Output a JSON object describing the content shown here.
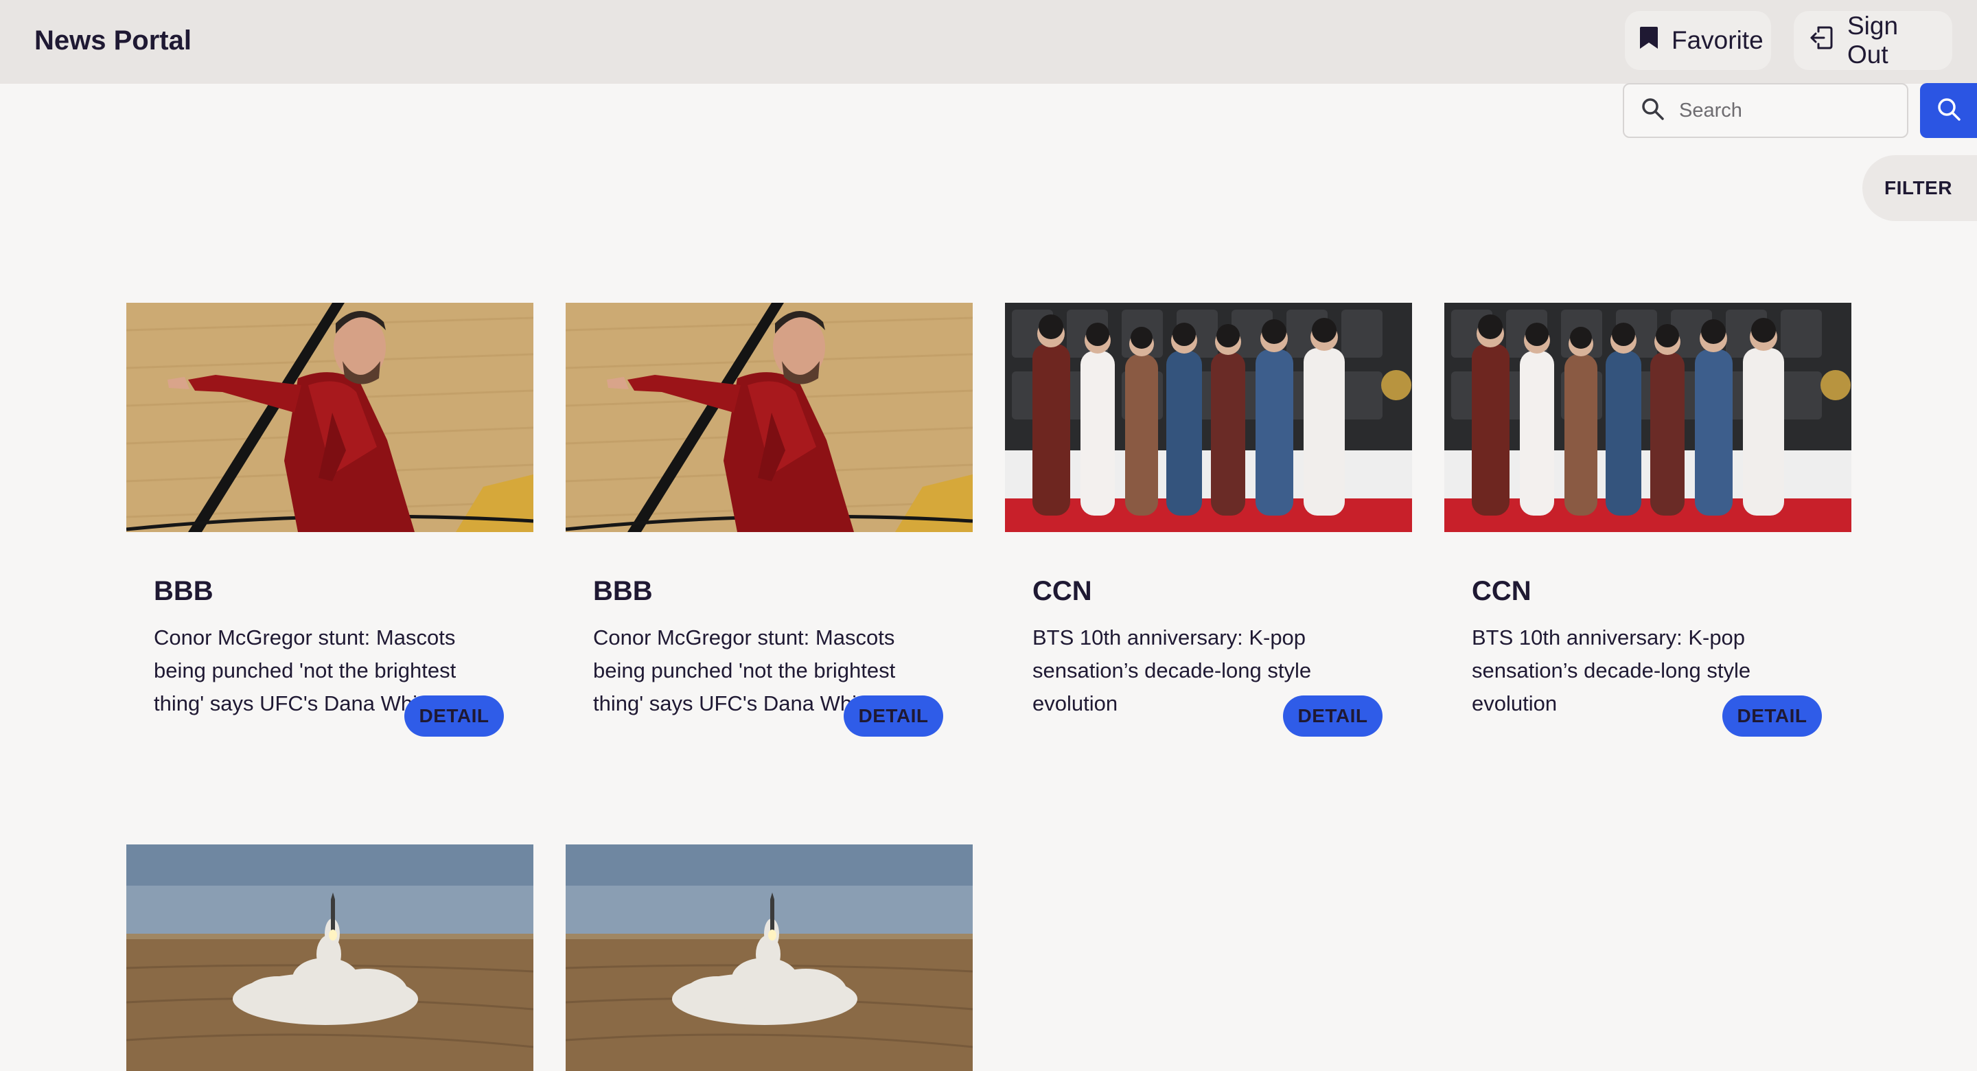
{
  "header": {
    "brand": "News Portal",
    "favorite_label": "Favorite",
    "signout_label": "Sign Out"
  },
  "search": {
    "placeholder": "Search"
  },
  "filter_label": "FILTER",
  "articles": [
    {
      "source": "BBB",
      "title": "Conor McGregor stunt: Mascots being punched 'not the brightest thing' says UFC's Dana White",
      "detail_label": "DETAIL",
      "image": "mcgregor-photo"
    },
    {
      "source": "BBB",
      "title": "Conor McGregor stunt: Mascots being punched 'not the brightest thing' says UFC's Dana White",
      "detail_label": "DETAIL",
      "image": "mcgregor-photo"
    },
    {
      "source": "CCN",
      "title": "BTS 10th anniversary: K-pop sensation’s decade-long style evolution",
      "detail_label": "DETAIL",
      "image": "bts-photo"
    },
    {
      "source": "CCN",
      "title": "BTS 10th anniversary: K-pop sensation’s decade-long style evolution",
      "detail_label": "DETAIL",
      "image": "bts-photo"
    },
    {
      "image": "missile-launch-photo"
    },
    {
      "image": "missile-launch-photo"
    }
  ],
  "colors": {
    "accent": "#2b55e3",
    "header_bg": "#e8e5e3",
    "page_bg": "#f7f6f5",
    "text": "#1f1933"
  },
  "icons": {
    "favorite": "bookmark-icon",
    "signout": "sign-out-icon",
    "search_field": "search-icon",
    "search_button": "search-icon"
  }
}
